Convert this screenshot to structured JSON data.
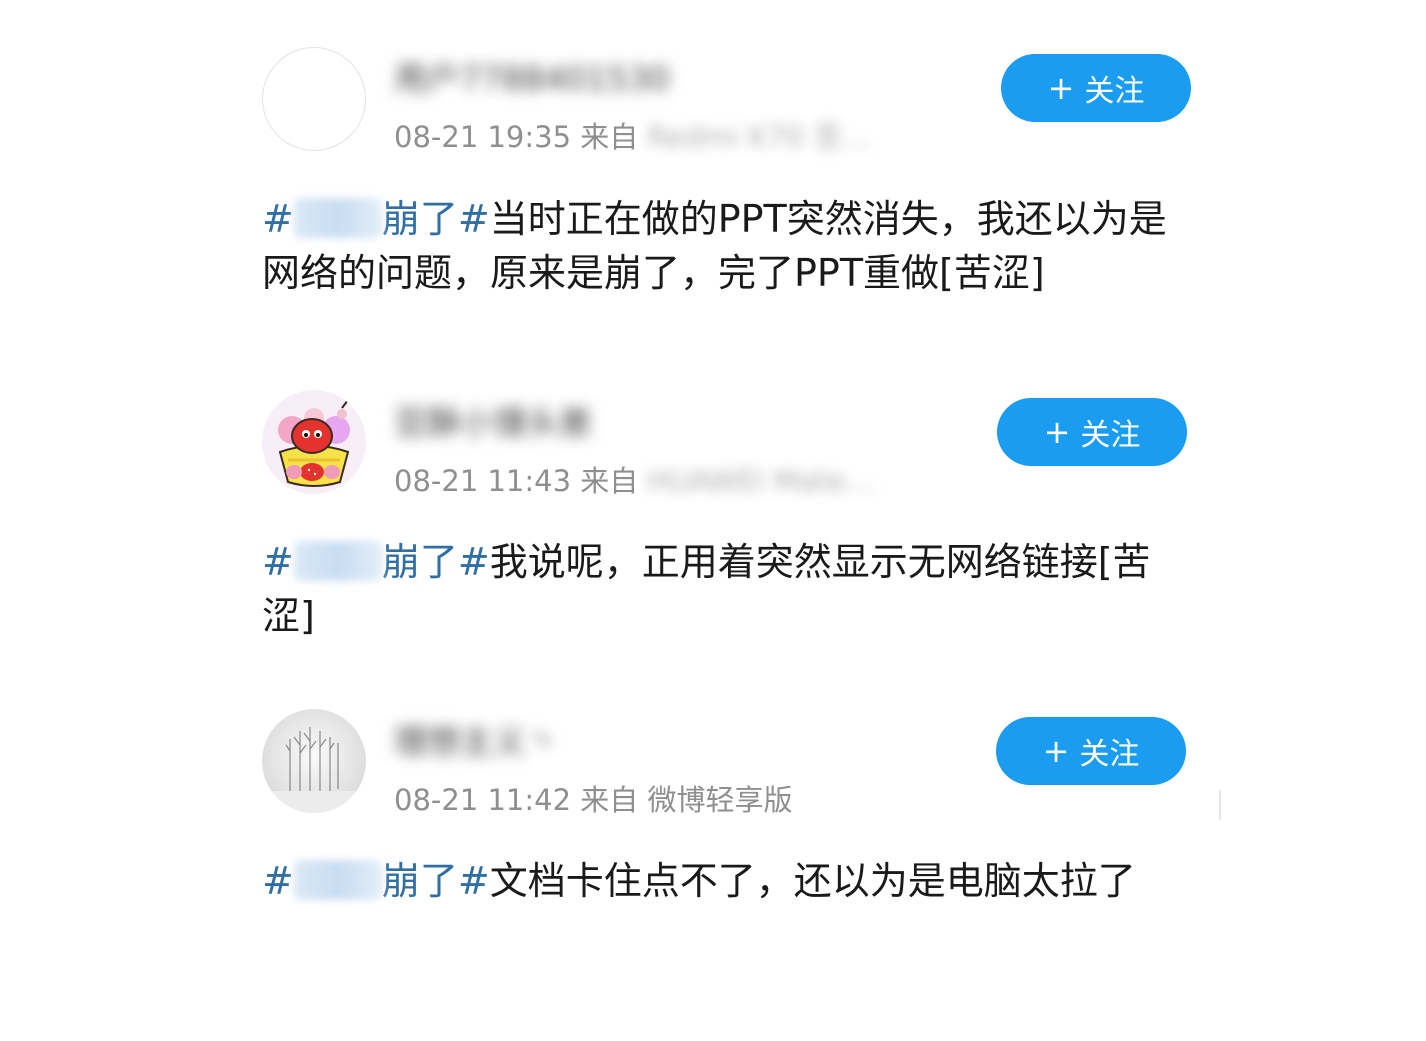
{
  "posts": [
    {
      "username": "用户7788401530",
      "time": "08-21 19:35",
      "from_label": "来自",
      "device": "Redmi K70 至…",
      "follow_label": "关注",
      "hashtag_prefix": "#",
      "hashtag_topic": "wps",
      "hashtag_suffix": "崩了#",
      "text": "当时正在做的PPT突然消失，我还以为是网络的问题，原来是崩了，完了PPT重做[苦涩]"
    },
    {
      "username": "豆酥小馒头崽",
      "time": "08-21 11:43",
      "from_label": "来自",
      "device": "HUAWEI Mate…",
      "follow_label": "关注",
      "hashtag_prefix": "#",
      "hashtag_topic": "wps",
      "hashtag_suffix": "崩了#",
      "text": "我说呢，正用着突然显示无网络链接[苦涩]"
    },
    {
      "username": "理想主义丶",
      "time": "08-21 11:42",
      "from_label": "来自",
      "device": "微博轻享版",
      "follow_label": "关注",
      "hashtag_prefix": "#",
      "hashtag_topic": "wps",
      "hashtag_suffix": "崩了#",
      "text": "文档卡住点不了，还以为是电脑太拉了"
    }
  ],
  "icons": {
    "follow": "plus-icon",
    "avatar_2": "cartoon-fruit-basket-icon",
    "avatar_3": "snowy-trees-photo"
  },
  "colors": {
    "follow_button": "#1a9cf1",
    "hashtag": "#2f6fa5",
    "meta_text": "#8f8f8f",
    "body_text": "#1a1a1a"
  }
}
